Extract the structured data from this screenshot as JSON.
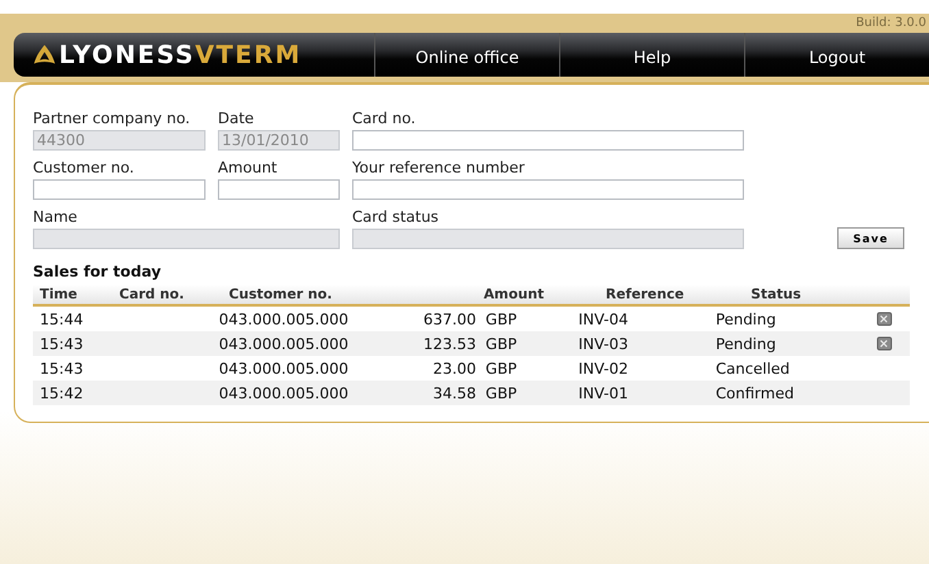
{
  "build": "Build: 3.0.0",
  "logo": {
    "part_1": "LYONESS",
    "part_2": "VTERM"
  },
  "nav": [
    {
      "label": "Online office"
    },
    {
      "label": "Help"
    },
    {
      "label": "Logout"
    }
  ],
  "form": {
    "fields": [
      {
        "label": "Partner company no.",
        "value": "44300",
        "disabled": true
      },
      {
        "label": "Date",
        "value": "13/01/2010",
        "disabled": true
      },
      {
        "label": "Card no.",
        "disabled": false
      },
      {
        "label": "Customer no.",
        "disabled": false
      },
      {
        "label": "Amount",
        "disabled": false
      },
      {
        "label": "Your reference number",
        "disabled": false
      },
      {
        "label": "Name",
        "disabled": true
      },
      {
        "label": "Card status",
        "disabled": true
      }
    ],
    "save": "Save"
  },
  "sales": {
    "title": "Sales for today",
    "columns": [
      "Time",
      "Card no.",
      "Customer no.",
      "Amount",
      "Reference",
      "Status"
    ],
    "rows": [
      {
        "time": "15:44",
        "customer": "043.000.005.000",
        "amount": "637.00",
        "currency": "GBP",
        "reference": "INV-04",
        "status": "Pending",
        "cancellable": true
      },
      {
        "time": "15:43",
        "customer": "043.000.005.000",
        "amount": "123.53",
        "currency": "GBP",
        "reference": "INV-03",
        "status": "Pending",
        "cancellable": true
      },
      {
        "time": "15:43",
        "customer": "043.000.005.000",
        "amount": "23.00",
        "currency": "GBP",
        "reference": "INV-02",
        "status": "Cancelled",
        "cancellable": false
      },
      {
        "time": "15:42",
        "customer": "043.000.005.000",
        "amount": "34.58",
        "currency": "GBP",
        "reference": "INV-01",
        "status": "Confirmed",
        "cancellable": false
      }
    ]
  }
}
